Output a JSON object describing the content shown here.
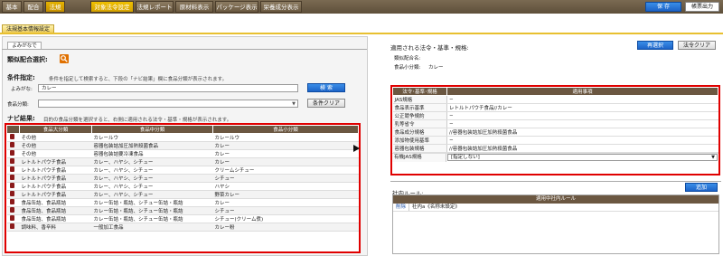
{
  "nav": {
    "main_tabs": [
      "基本",
      "配合",
      "法規"
    ],
    "sub_tabs": [
      "対象法令設定",
      "法規レポート",
      "原材料表示",
      "パッケージ表示",
      "栄養成分表示"
    ],
    "save_label": "保 存",
    "print_label": "帳票出力"
  },
  "section_tab": "法規基本情報設定",
  "left": {
    "search_tab": "よみがなで",
    "category_select_label": "類似配合選択:",
    "condition_label": "条件指定:",
    "condition_hint": "条件を指定して検索すると、下段の「ナビ結果」欄に食品分類が表示されます。",
    "reading_label": "よみがな:",
    "reading_value": "カレー",
    "search_button": "検 索",
    "classification_label": "食品分類:",
    "clear_button": "条件クリア",
    "navi_label": "ナビ結果:",
    "navi_hint": "目的の食品分類を選択すると、右側に適用される法令・基準・規格が表示されます。",
    "table": {
      "headers": [
        "食品大分類",
        "食品中分類",
        "食品小分類"
      ],
      "rows": [
        [
          "その他",
          "カレールウ",
          "カレールウ"
        ],
        [
          "その他",
          "容器包装詰加圧加熱殺菌食品",
          "カレー"
        ],
        [
          "その他",
          "容器包装詰要冷凍食品",
          "カレー"
        ],
        [
          "レトルトパウチ食品",
          "カレー、ハヤシ、シチュー",
          "カレー"
        ],
        [
          "レトルトパウチ食品",
          "カレー、ハヤシ、シチュー",
          "クリームシチュー"
        ],
        [
          "レトルトパウチ食品",
          "カレー、ハヤシ、シチュー",
          "シチュー"
        ],
        [
          "レトルトパウチ食品",
          "カレー、ハヤシ、シチュー",
          "ハヤシ"
        ],
        [
          "レトルトパウチ食品",
          "カレー、ハヤシ、シチュー",
          "野菜カレー"
        ],
        [
          "食品缶詰、食品瓶詰",
          "カレー缶詰・瓶詰、シチュー缶詰・瓶詰",
          "カレー"
        ],
        [
          "食品缶詰、食品瓶詰",
          "カレー缶詰・瓶詰、シチュー缶詰・瓶詰",
          "シチュー"
        ],
        [
          "食品缶詰、食品瓶詰",
          "カレー缶詰・瓶詰、シチュー缶詰・瓶詰",
          "シチュー(クリーム煮)"
        ],
        [
          "調味料、香辛料",
          "一般加工食品",
          "カレー粉"
        ]
      ]
    }
  },
  "right": {
    "title": "適用される法令・基準・規格:",
    "reselect_button": "再選択",
    "clear_button": "法令クリア",
    "similar_label": "類似配合名:",
    "small_class_label": "食品小分類:",
    "small_class_value": "カレー",
    "table": {
      "headers": [
        "法令･基準･規格",
        "適用事項"
      ],
      "rows": [
        [
          "JAS規格",
          "−"
        ],
        [
          "食品表示基準",
          "レトルトパウチ食品//カレー"
        ],
        [
          "公正競争規約",
          "−"
        ],
        [
          "乳等省令",
          "−"
        ],
        [
          "食品成分規格",
          "//容器包装詰加圧加熱殺菌食品"
        ],
        [
          "添加物使用基準",
          "−"
        ],
        [
          "容器包装規格",
          "//容器包装詰加圧加熱殺菌食品"
        ]
      ],
      "select_label": "有機JAS規格",
      "select_value": "[指定しない]"
    },
    "rule_label": "社内ルール:",
    "add_button": "追加",
    "rule_header": "適用中社内ルール",
    "rule_delete": "削除",
    "rule_value": "社内a《名称未設定》"
  }
}
